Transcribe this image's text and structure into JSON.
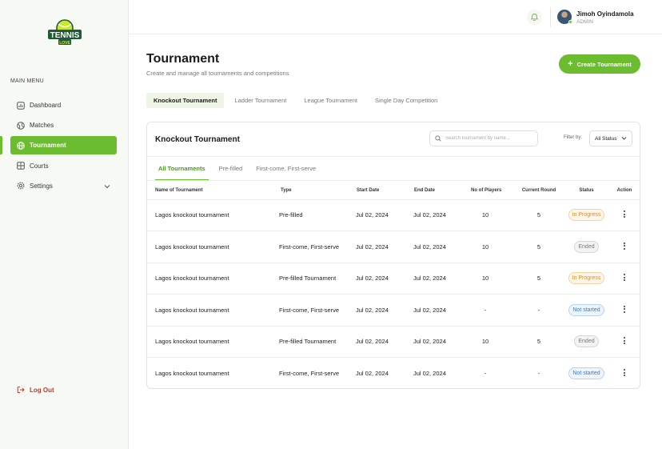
{
  "brand": {
    "logo_text": "TENNIS",
    "logo_sub": "LOVE"
  },
  "sidebar": {
    "menu_title": "MAIN MENU",
    "items": [
      {
        "label": "Dashboard",
        "icon": "dashboard-icon"
      },
      {
        "label": "Matches",
        "icon": "tennis-ball-icon"
      },
      {
        "label": "Tournament",
        "icon": "globe-icon",
        "active": true
      },
      {
        "label": "Courts",
        "icon": "court-icon"
      },
      {
        "label": "Settings",
        "icon": "gear-icon"
      }
    ],
    "logout_label": "Log Out"
  },
  "user": {
    "name": "Jimoh Oyindamola",
    "role": "ADMIN"
  },
  "header": {
    "title": "Tournament",
    "subtitle": "Create and manage all tournaments and competitions",
    "create_button": "Create Tournament"
  },
  "tabs": [
    {
      "label": "Knockout Tournament",
      "active": true
    },
    {
      "label": "Ladder Tournament"
    },
    {
      "label": "League Tournament"
    },
    {
      "label": "Single Day Competition"
    }
  ],
  "card": {
    "title": "Knockout Tournament",
    "search_placeholder": "Search tournament by name...",
    "filter_label": "Filter by:",
    "filter_value": "All Status",
    "subtabs": [
      {
        "label": "All Tournaments",
        "active": true
      },
      {
        "label": "Pre-filled"
      },
      {
        "label": "First-come, First-serve"
      }
    ]
  },
  "table": {
    "columns": [
      "Name of Tournament",
      "Type",
      "Start Date",
      "End Date",
      "No of Players",
      "Current Round",
      "Status",
      "Action"
    ],
    "rows": [
      {
        "name": "Lagos knockout tournament",
        "type": "Pre-filled",
        "start": "Jul 02, 2024",
        "end": "Jul 02, 2024",
        "players": "10",
        "round": "5",
        "status": "In Progress"
      },
      {
        "name": "Lagos knockout tournament",
        "type": "First-come, First-serve",
        "start": "Jul 02, 2024",
        "end": "Jul 02, 2024",
        "players": "10",
        "round": "5",
        "status": "Ended"
      },
      {
        "name": "Lagos knockout tournament",
        "type": "Pre-filled Tournament",
        "start": "Jul 02, 2024",
        "end": "Jul 02, 2024",
        "players": "10",
        "round": "5",
        "status": "In Progress"
      },
      {
        "name": "Lagos knockout tournament",
        "type": "First-come, First-serve",
        "start": "Jul 02, 2024",
        "end": "Jul 02, 2024",
        "players": "-",
        "round": "-",
        "status": "Not started"
      },
      {
        "name": "Lagos knockout tournament",
        "type": "Pre-filled Tournament",
        "start": "Jul 02, 2024",
        "end": "Jul 02, 2024",
        "players": "10",
        "round": "5",
        "status": "Ended"
      },
      {
        "name": "Lagos knockout tournament",
        "type": "First-come, First-serve",
        "start": "Jul 02, 2024",
        "end": "Jul 02, 2024",
        "players": "-",
        "round": "-",
        "status": "Not started"
      }
    ]
  },
  "colors": {
    "accent": "#6bbd2f",
    "status": {
      "In Progress": {
        "fg": "#e08a1e",
        "bg": "#fff6ea",
        "border": "#f3d2a6"
      },
      "Ended": {
        "fg": "#777777",
        "bg": "#f3f3f3",
        "border": "#d6d6d6"
      },
      "Not started": {
        "fg": "#3a7bc8",
        "bg": "#edf4fc",
        "border": "#b8d2ef"
      }
    }
  }
}
